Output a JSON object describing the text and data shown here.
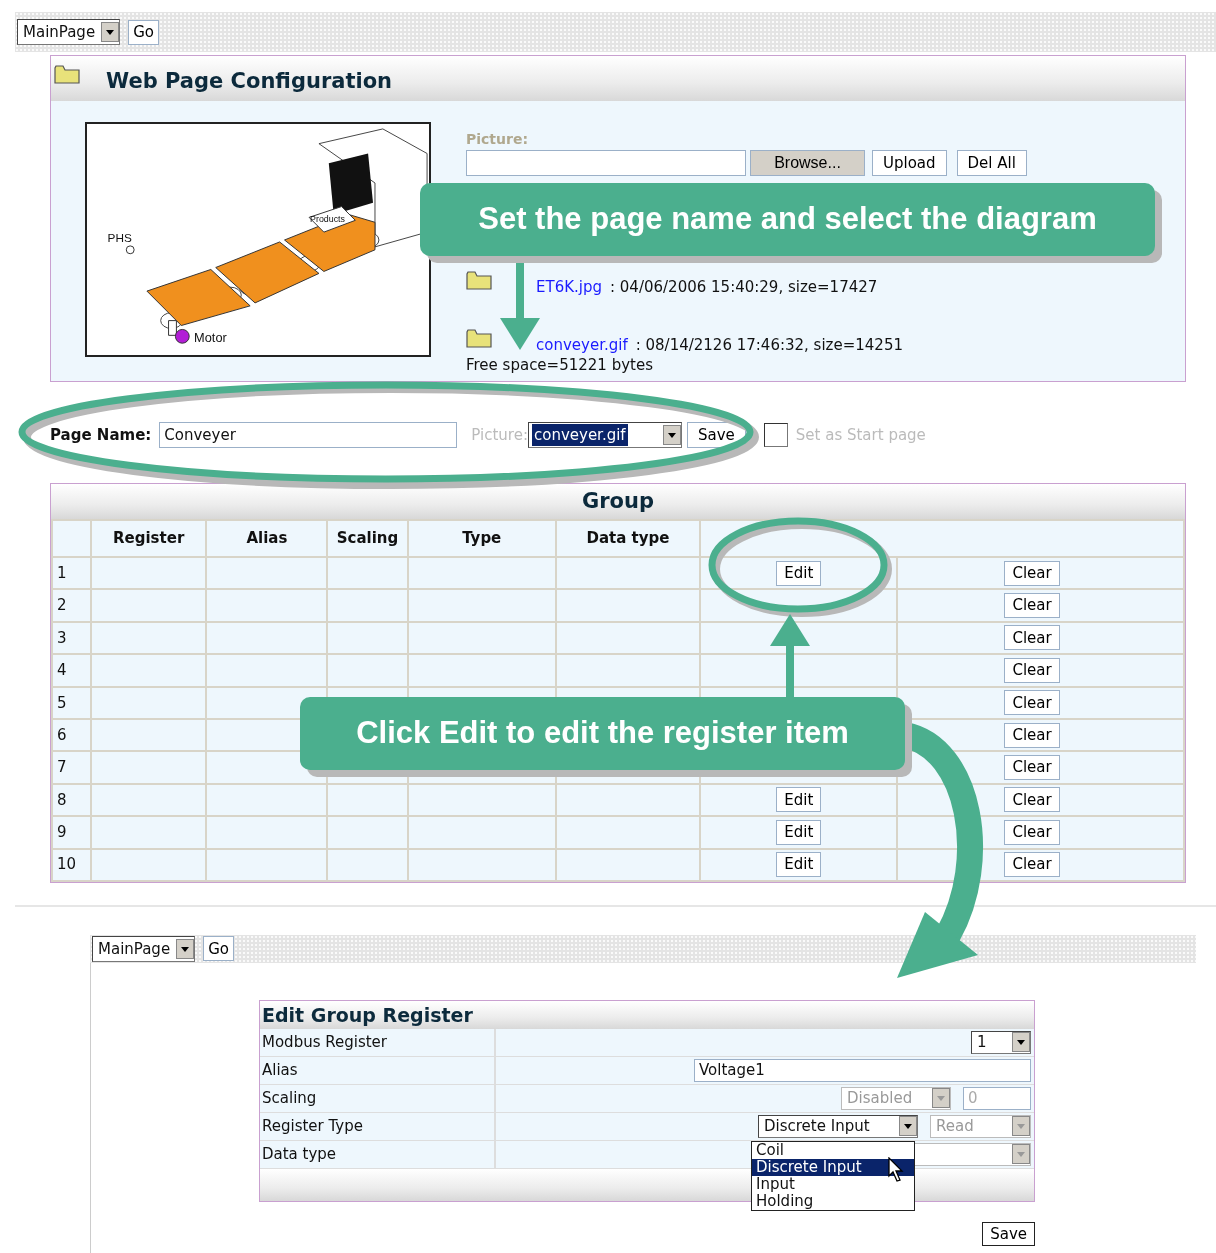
{
  "top_nav": {
    "page_select": "MainPage",
    "go": "Go"
  },
  "config_panel": {
    "title": "Web Page Configuration",
    "diagram_labels": [
      "PHS",
      "Motor",
      "Products"
    ],
    "upload": {
      "label": "Picture:",
      "browse": "Browse...",
      "upload": "Upload",
      "del_all": "Del All"
    },
    "files": [
      {
        "name": "ET6K.jpg",
        "info": ": 04/06/2006 15:40:29, size=17427"
      },
      {
        "name": "conveyer.gif",
        "info": ": 08/14/2126 17:46:32, size=14251"
      }
    ],
    "free_space": "Free space=51221 bytes"
  },
  "page_settings": {
    "name_label": "Page Name:",
    "name_value": "Conveyer",
    "picture_label": "Picture:",
    "picture_value": "conveyer.gif",
    "save": "Save",
    "start_page_checked": false,
    "start_page_label": "Set as Start page"
  },
  "group": {
    "title": "Group",
    "columns": [
      "Register",
      "Alias",
      "Scaling",
      "Type",
      "Data type"
    ],
    "rows": [
      {
        "number": "1",
        "edit": "Edit",
        "clear": "Clear"
      },
      {
        "number": "2",
        "clear": "Clear"
      },
      {
        "number": "3",
        "clear": "Clear"
      },
      {
        "number": "4",
        "clear": "Clear"
      },
      {
        "number": "5",
        "clear": "Clear"
      },
      {
        "number": "6",
        "clear": "Clear"
      },
      {
        "number": "7",
        "clear": "Clear"
      },
      {
        "number": "8",
        "edit": "Edit",
        "clear": "Clear"
      },
      {
        "number": "9",
        "edit": "Edit",
        "clear": "Clear"
      },
      {
        "number": "10",
        "edit": "Edit",
        "clear": "Clear"
      }
    ]
  },
  "callouts": [
    {
      "text": "Set the page name and select the diagram"
    },
    {
      "text": "Click Edit to edit the register item"
    }
  ],
  "bottom_nav": {
    "page_select": "MainPage",
    "go": "Go"
  },
  "edit_register": {
    "title": "Edit Group Register",
    "fields": [
      {
        "label": "Modbus Register",
        "controls": [
          {
            "kind": "select",
            "value": "1",
            "disabled": false
          }
        ]
      },
      {
        "label": "Alias",
        "controls": [
          {
            "kind": "input",
            "value": "Voltage1",
            "disabled": false
          }
        ]
      },
      {
        "label": "Scaling",
        "controls": [
          {
            "kind": "select",
            "value": "Disabled",
            "disabled": true
          },
          {
            "kind": "input",
            "value": "0",
            "disabled": true
          }
        ]
      },
      {
        "label": "Register Type",
        "controls": [
          {
            "kind": "select",
            "value": "Discrete Input",
            "disabled": false
          },
          {
            "kind": "select",
            "value": "Read",
            "disabled": true
          }
        ]
      },
      {
        "label": "Data type",
        "controls": [
          {
            "kind": "select",
            "disabled": true
          }
        ]
      }
    ],
    "dropdown": [
      {
        "label": "Coil",
        "selected": false
      },
      {
        "label": "Discrete Input",
        "selected": true
      },
      {
        "label": "Input",
        "selected": false
      },
      {
        "label": "Holding",
        "selected": false
      }
    ],
    "save": "Save"
  }
}
